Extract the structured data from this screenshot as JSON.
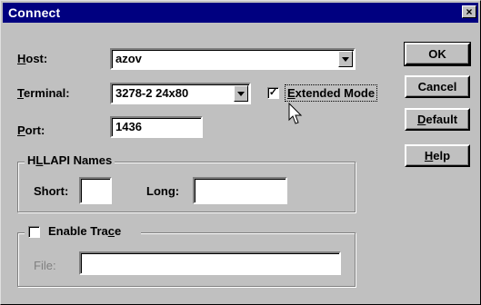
{
  "window": {
    "title": "Connect",
    "close_glyph": "×"
  },
  "host": {
    "label_pre": "",
    "label_u": "H",
    "label_post": "ost:",
    "value": "azov"
  },
  "terminal": {
    "label_pre": "",
    "label_u": "T",
    "label_post": "erminal:",
    "value": "3278-2 24x80"
  },
  "extended_mode": {
    "label_pre": "",
    "label_u": "E",
    "label_post": "xtended Mode",
    "checked": true,
    "check_glyph": "✓"
  },
  "port": {
    "label_pre": "",
    "label_u": "P",
    "label_post": "ort:",
    "value": "1436"
  },
  "hllapi": {
    "title_pre": "H",
    "title_u": "L",
    "title_post": "LAPI Names",
    "short_label": "Short:",
    "short_value": "",
    "long_label": "Long:",
    "long_value": ""
  },
  "trace": {
    "label_pre": "Enable Tra",
    "label_u": "c",
    "label_post": "e",
    "checked": false,
    "file_label": "File:",
    "file_value": ""
  },
  "buttons": {
    "ok": "OK",
    "cancel": "Cancel",
    "default_pre": "",
    "default_u": "D",
    "default_post": "efault",
    "help_pre": "",
    "help_u": "H",
    "help_post": "elp"
  },
  "icons": {
    "close": "close-icon",
    "dropdown": "chevron-down-icon",
    "cursor": "mouse-pointer-icon"
  }
}
